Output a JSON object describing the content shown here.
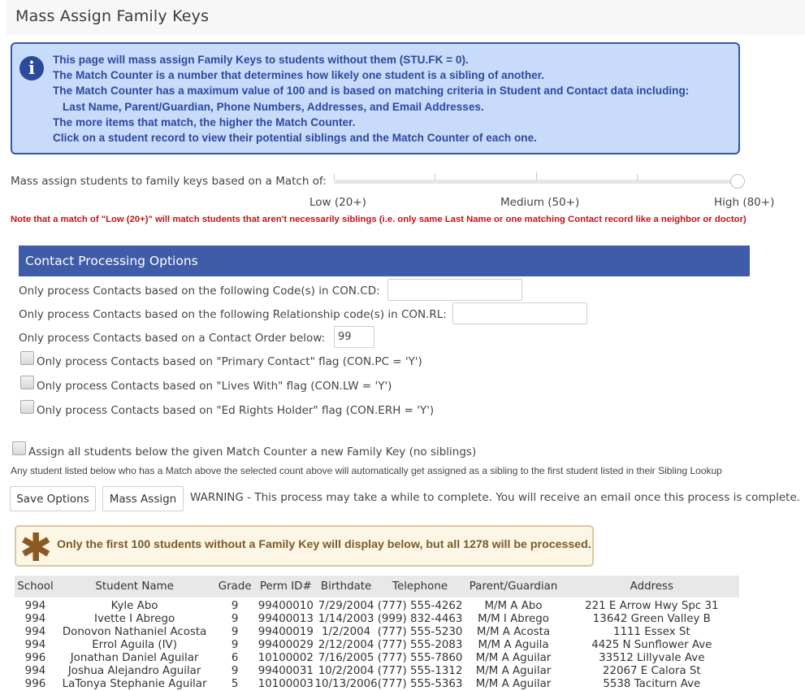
{
  "page": {
    "title": "Mass Assign Family Keys"
  },
  "info": {
    "lines": [
      "This page will mass assign Family Keys to students without them (STU.FK = 0).",
      "The Match Counter is a number that determines how likely one student is a sibling of another.",
      "The Match Counter has a maximum value of 100 and is based on matching criteria in Student and Contact data including:",
      "Last Name, Parent/Guardian, Phone Numbers, Addresses, and Email Addresses.",
      "The more items that match, the higher the Match Counter.",
      "Click on a student record to view their potential siblings and the Match Counter of each one."
    ]
  },
  "slider": {
    "label": "Mass assign students to family keys based on a Match of:",
    "low": "Low (20+)",
    "medium": "Medium (50+)",
    "high": "High (80+)",
    "value_percent": 100,
    "note": "Note that a match of \"Low (20+)\" will match students that aren't necessarily siblings (i.e. only same Last Name or one matching Contact record like a neighbor or doctor)"
  },
  "contact_options": {
    "header": "Contact Processing Options",
    "code_label": "Only process Contacts based on the following Code(s) in CON.CD:",
    "code_value": "",
    "relationship_label": "Only process Contacts based on the following Relationship code(s) in CON.RL:",
    "relationship_value": "",
    "order_label": "Only process Contacts based on a Contact Order below:",
    "order_value": "99",
    "primary_label": "Only process Contacts based on \"Primary Contact\" flag (CON.PC = 'Y')",
    "lives_with_label": "Only process Contacts based on \"Lives With\" flag (CON.LW = 'Y')",
    "ed_rights_label": "Only process Contacts based on \"Ed Rights Holder\" flag (CON.ERH = 'Y')"
  },
  "assign_no_siblings_label": "Assign all students below the given Match Counter a new Family Key (no siblings)",
  "auto_assign_note": "Any student listed below who has a Match above the selected count above will automatically get assigned as a sibling to the first student listed in their Sibling Lookup",
  "buttons": {
    "save": "Save Options",
    "mass_assign": "Mass Assign"
  },
  "process_warning": "WARNING - This process may take a while to complete. You will receive an email once this process is complete.",
  "notice": "Only the first 100 students without a Family Key will display below, but all 1278 will be processed.",
  "table": {
    "headers": [
      "School",
      "Student Name",
      "Grade",
      "Perm ID#",
      "Birthdate",
      "Telephone",
      "Parent/Guardian",
      "Address"
    ],
    "rows": [
      [
        "994",
        "Kyle Abo",
        "9",
        "99400010",
        "7/29/2004",
        "(777) 555-4262",
        "M/M A Abo",
        "221 E Arrow Hwy Spc 31"
      ],
      [
        "994",
        "Ivette I Abrego",
        "9",
        "99400013",
        "1/14/2003",
        "(999) 832-4463",
        "M/M I Abrego",
        "13642 Green Valley B"
      ],
      [
        "994",
        "Donovon Nathaniel Acosta",
        "9",
        "99400019",
        "1/2/2004",
        "(777) 555-5230",
        "M/M A Acosta",
        "1111 Essex St"
      ],
      [
        "994",
        "Errol Aguila (IV)",
        "9",
        "99400029",
        "2/12/2004",
        "(777) 555-2083",
        "M/M A Aguila",
        "4425 N Sunflower Ave"
      ],
      [
        "996",
        "Jonathan Daniel Aguilar",
        "6",
        "10100002",
        "7/16/2005",
        "(777) 555-7860",
        "M/M A Aguilar",
        "33512 Lillyvale Ave"
      ],
      [
        "994",
        "Joshua Alejandro Aguilar",
        "9",
        "99400031",
        "10/2/2004",
        "(777) 555-1312",
        "M/M A Aguilar",
        "22067 E Calora St"
      ],
      [
        "996",
        "LaTonya Stephanie Aguilar",
        "5",
        "10100003",
        "10/13/2006",
        "(777) 555-5363",
        "M/M A Aguilar",
        "5538 Taciturn Ave"
      ]
    ]
  }
}
